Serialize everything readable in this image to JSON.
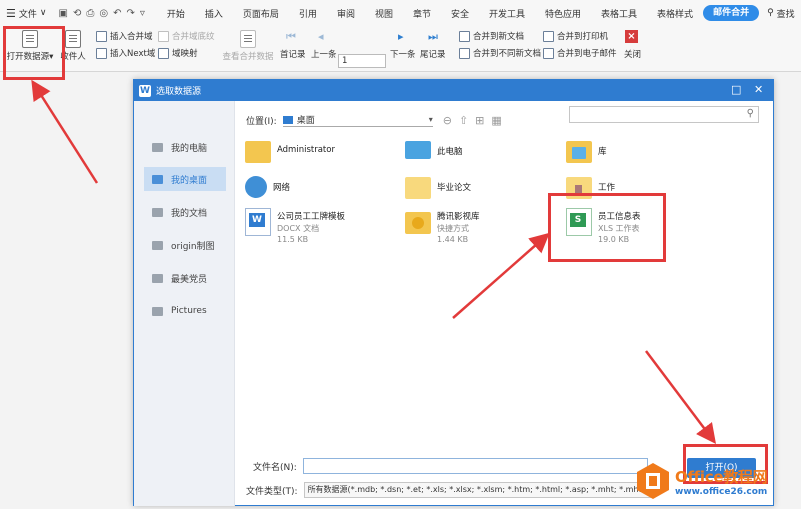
{
  "ribbon": {
    "file_menu": "文件",
    "tabs": [
      "开始",
      "插入",
      "页面布局",
      "引用",
      "审阅",
      "视图",
      "章节",
      "安全",
      "开发工具",
      "特色应用",
      "表格工具",
      "表格样式",
      "邮件合并"
    ],
    "active_tab": "邮件合并",
    "search_label": "查找",
    "tools": {
      "open_datasource": "打开数据源",
      "recipients": "收件人",
      "insert_merge_field": "插入合并域",
      "merge_field_shading": "合并域底纹",
      "insert_next_field": "插入Next域",
      "field_mapping": "域映射",
      "view_merged_data": "查看合并数据",
      "first_record": "首记录",
      "prev_record": "上一条",
      "record_number": "1",
      "next_record": "下一条",
      "last_record": "尾记录",
      "merge_to_new_doc": "合并到新文档",
      "merge_to_different_docs": "合并到不同新文档",
      "merge_to_printer": "合并到打印机",
      "merge_to_email": "合并到电子邮件",
      "close": "关闭"
    }
  },
  "dialog": {
    "title": "选取数据源",
    "sidebar": [
      "我的电脑",
      "我的桌面",
      "我的文档",
      "origin制图",
      "最美党员",
      "Pictures"
    ],
    "selected_sidebar": "我的桌面",
    "location_label": "位置(I):",
    "location_value": "桌面",
    "files": [
      {
        "name": "Administrator",
        "type": "",
        "size": ""
      },
      {
        "name": "此电脑",
        "type": "",
        "size": ""
      },
      {
        "name": "库",
        "type": "",
        "size": ""
      },
      {
        "name": "网络",
        "type": "",
        "size": ""
      },
      {
        "name": "毕业论文",
        "type": "",
        "size": ""
      },
      {
        "name": "工作",
        "type": "",
        "size": ""
      },
      {
        "name": "公司员工工牌模板",
        "type": "DOCX 文档",
        "size": "11.5 KB"
      },
      {
        "name": "腾讯影视库",
        "type": "快捷方式",
        "size": "1.44 KB"
      },
      {
        "name": "员工信息表",
        "type": "XLS 工作表",
        "size": "19.0 KB"
      }
    ],
    "filename_label": "文件名(N):",
    "filename_value": "",
    "filetype_label": "文件类型(T):",
    "filetype_value": "所有数据源(*.mdb; *.dsn; *.et; *.xls; *.xlsx; *.xlsm; *.htm; *.html; *.asp; *.mht; *.mhtml; *.rtf; *.",
    "open_button": "打开(O)"
  },
  "watermark": {
    "title": "Office教程网",
    "url": "www.office26.com"
  },
  "colors": {
    "accent": "#2f7cd0",
    "annotation": "#e23a3a",
    "watermark_orange": "#f07a1a"
  }
}
